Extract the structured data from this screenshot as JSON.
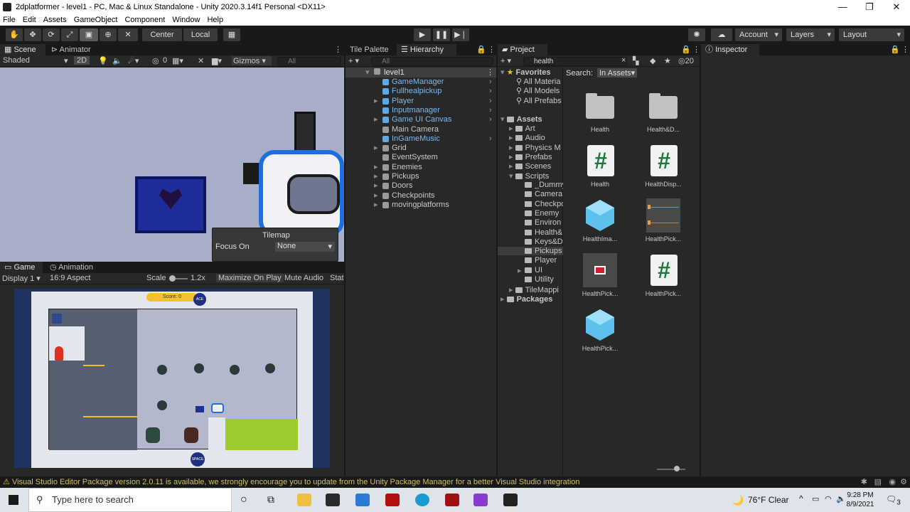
{
  "window": {
    "title": "2dplatformer - level1 - PC, Mac & Linux Standalone - Unity 2020.3.14f1 Personal <DX11>",
    "minimize": "—",
    "maximize": "❐",
    "close": "✕"
  },
  "menu": [
    "File",
    "Edit",
    "Assets",
    "GameObject",
    "Component",
    "Window",
    "Help"
  ],
  "toolbar": {
    "pivot_label": "Center",
    "space_label": "Local",
    "account_label": "Account",
    "layers_label": "Layers",
    "layout_label": "Layout"
  },
  "scene": {
    "tab_scene": "Scene",
    "tab_animator": "Animator",
    "shading": "Shaded",
    "mode_2d": "2D",
    "hidden_count": "0",
    "gizmos": "Gizmos",
    "search_placeholder": "All",
    "overlay_title": "Tilemap",
    "overlay_focus_label": "Focus On",
    "overlay_focus_value": "None"
  },
  "game": {
    "tab_game": "Game",
    "tab_animation": "Animation",
    "display": "Display 1",
    "aspect": "16:9 Aspect",
    "scale_label": "Scale",
    "scale_value": "1.2x",
    "maximize_on_play": "Maximize On Play",
    "mute_audio": "Mute Audio",
    "stats": "Stat",
    "score_text": "Score: 0",
    "badge_top": "ACE",
    "badge_bottom": "SPACE"
  },
  "hierarchy": {
    "tab_palette": "Tile Palette",
    "tab_hierarchy": "Hierarchy",
    "search_placeholder": "All",
    "scene_name": "level1",
    "items": [
      {
        "label": "GameManager",
        "prefab": true
      },
      {
        "label": "Fullhealpickup",
        "prefab": true
      },
      {
        "label": "Player",
        "prefab": true
      },
      {
        "label": "Inputmanager",
        "prefab": true
      },
      {
        "label": "Game UI Canvas",
        "prefab": true
      },
      {
        "label": "Main Camera",
        "prefab": false
      },
      {
        "label": "InGameMusic",
        "prefab": true
      },
      {
        "label": "Grid",
        "prefab": false
      },
      {
        "label": "EventSystem",
        "prefab": false
      },
      {
        "label": "Enemies",
        "prefab": false
      },
      {
        "label": "Pickups",
        "prefab": false
      },
      {
        "label": "Doors",
        "prefab": false
      },
      {
        "label": "Checkpoints",
        "prefab": false
      },
      {
        "label": "movingplatforms",
        "prefab": false
      }
    ]
  },
  "project": {
    "tab": "Project",
    "search_value": "health",
    "hidden_count": "20",
    "search_label": "Search:",
    "search_scope": "In Assets",
    "favorites_label": "Favorites",
    "favorites": [
      "All Materia",
      "All Models",
      "All Prefabs"
    ],
    "assets_label": "Assets",
    "folders": [
      "Art",
      "Audio",
      "Physics M",
      "Prefabs",
      "Scenes",
      "Scripts"
    ],
    "script_folders": [
      "_Dummy",
      "Camera",
      "Checkpo",
      "Enemy",
      "Environ",
      "Health&",
      "Keys&D",
      "Pickups",
      "Player",
      "UI",
      "Utility"
    ],
    "tile_folder": "TileMappi",
    "packages_label": "Packages",
    "assets": [
      {
        "name": "Health",
        "kind": "folder"
      },
      {
        "name": "Health&D...",
        "kind": "folder"
      },
      {
        "name": "Health",
        "kind": "script"
      },
      {
        "name": "HealthDisp...",
        "kind": "script"
      },
      {
        "name": "HealthIma...",
        "kind": "prefab"
      },
      {
        "name": "HealthPick...",
        "kind": "anim"
      },
      {
        "name": "HealthPick...",
        "kind": "sprite"
      },
      {
        "name": "HealthPick...",
        "kind": "script"
      },
      {
        "name": "HealthPick...",
        "kind": "prefab"
      }
    ],
    "hash_glyph": "#"
  },
  "inspector": {
    "tab": "Inspector"
  },
  "status": {
    "message": "Visual Studio Editor Package version 2.0.11 is available, we strongly encourage you to update from the Unity Package Manager for a better Visual Studio integration"
  },
  "taskbar": {
    "search_placeholder": "Type here to search",
    "weather": "76°F  Clear",
    "time": "9:28 PM",
    "date": "8/9/2021",
    "notifications": "3"
  },
  "colors": {
    "editor_bg": "#282828",
    "prefab_blue": "#7cb8f0",
    "warning_yellow": "#f0c030",
    "scene_bg": "#a8aec8"
  }
}
